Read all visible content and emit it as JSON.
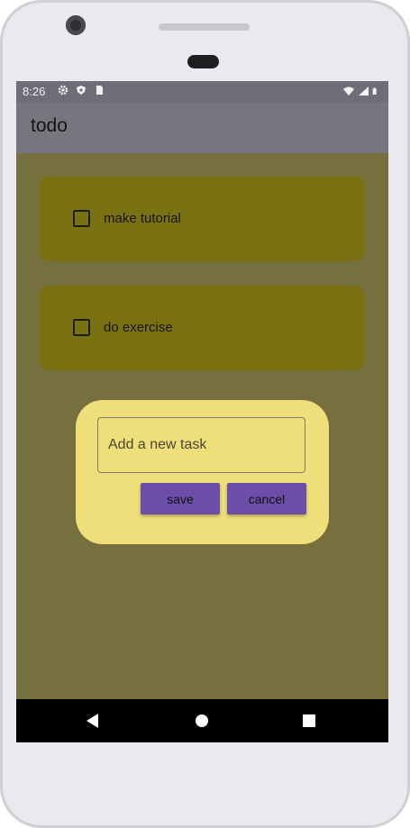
{
  "status": {
    "time": "8:26",
    "left_icons": [
      "gear-icon",
      "shield-icon",
      "sim-card-icon"
    ],
    "right_icons": [
      "wifi-icon",
      "signal-icon",
      "battery-icon"
    ]
  },
  "appbar": {
    "title": "todo"
  },
  "tasks": [
    {
      "label": "make tutorial",
      "checked": false
    },
    {
      "label": "do exercise",
      "checked": false
    }
  ],
  "dialog": {
    "input_placeholder": "Add a new task",
    "save_label": "save",
    "cancel_label": "cancel"
  },
  "fab": {
    "icon": "plus-icon",
    "symbol": "+"
  },
  "navbar": {
    "icons": [
      "back-icon",
      "home-icon",
      "recents-icon"
    ]
  },
  "colors": {
    "card": "#7a7212",
    "dialog": "#eedf7a",
    "button": "#6b4ea8",
    "scrim": "#76703f"
  }
}
